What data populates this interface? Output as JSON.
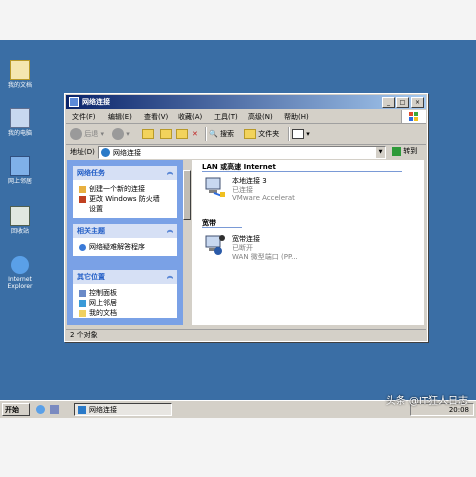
{
  "desktop": {
    "icons": [
      {
        "label": "我的文档"
      },
      {
        "label": "我的电脑"
      },
      {
        "label": "网上邻居"
      },
      {
        "label": "回收站"
      },
      {
        "label": "Internet Explorer"
      }
    ]
  },
  "window": {
    "title": "网络连接",
    "controls": {
      "minimize": "_",
      "maximize": "□",
      "close": "×"
    },
    "menu": [
      "文件(F)",
      "编辑(E)",
      "查看(V)",
      "收藏(A)",
      "工具(T)",
      "高级(N)",
      "帮助(H)"
    ],
    "toolbar": {
      "back": "后退",
      "search": "搜索",
      "folders": "文件夹"
    },
    "address": {
      "label": "地址(D)",
      "value": "网络连接",
      "go": "转到"
    },
    "tasks": [
      {
        "title": "网络任务",
        "items": [
          "创建一个新的连接",
          "更改 Windows 防火墙",
          "设置"
        ]
      },
      {
        "title": "相关主题",
        "items": [
          "网络疑难解答程序"
        ]
      },
      {
        "title": "其它位置",
        "items": [
          "控制面板",
          "网上邻居",
          "我的文档"
        ]
      }
    ],
    "groups": [
      {
        "title": "LAN 或高速 Internet",
        "connection": {
          "name": "本地连接 3",
          "status": "已连接",
          "device": "VMware Accelerat"
        }
      },
      {
        "title": "宽带",
        "connection": {
          "name": "宽带连接",
          "status": "已断开",
          "device": "WAN 微型端口 (PP..."
        }
      }
    ],
    "status": "2 个对象"
  },
  "taskbar": {
    "start": "开始",
    "item": "网络连接",
    "clock": "20:08"
  },
  "watermark": "头条 @IT狂人日志"
}
